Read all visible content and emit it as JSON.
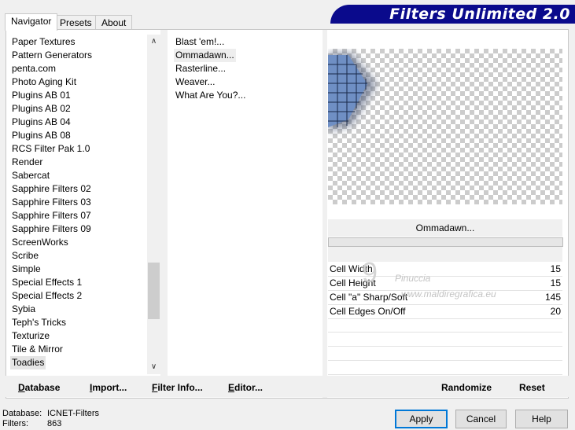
{
  "tabs": [
    {
      "label": "Navigator",
      "active": true
    },
    {
      "label": "Presets",
      "active": false
    },
    {
      "label": "About",
      "active": false
    }
  ],
  "banner": {
    "title": "Filters Unlimited 2.0"
  },
  "categories": [
    "Paper Textures",
    "Pattern Generators",
    "penta.com",
    "Photo Aging Kit",
    "Plugins AB 01",
    "Plugins AB 02",
    "Plugins AB 04",
    "Plugins AB 08",
    "RCS Filter Pak 1.0",
    "Render",
    "Sabercat",
    "Sapphire Filters 02",
    "Sapphire Filters 03",
    "Sapphire Filters 07",
    "Sapphire Filters 09",
    "ScreenWorks",
    "Scribe",
    "Simple",
    "Special Effects 1",
    "Special Effects 2",
    "Sybia",
    "Teph's Tricks",
    "Texturize",
    "Tile & Mirror",
    "Toadies"
  ],
  "selected_category": "Toadies",
  "filters": [
    "Blast 'em!...",
    "Ommadawn...",
    "Rasterline...",
    "Weaver...",
    "What Are You?..."
  ],
  "selected_filter": "Ommadawn...",
  "filter_name_label": "Ommadawn...",
  "parameters": [
    {
      "label": "Cell Width",
      "value": "15"
    },
    {
      "label": "Cell Height",
      "value": "15"
    },
    {
      "label": "Cell \"a\" Sharp/Soft",
      "value": "145"
    },
    {
      "label": "Cell Edges On/Off",
      "value": "20"
    }
  ],
  "left_buttons": {
    "database": {
      "underlined": "D",
      "rest": "atabase"
    },
    "import": {
      "underlined": "I",
      "rest": "mport..."
    },
    "filter_info": {
      "underlined": "F",
      "rest": "ilter Info..."
    },
    "editor": {
      "underlined": "E",
      "rest": "ditor..."
    }
  },
  "right_buttons": {
    "randomize": "Randomize",
    "reset": "Reset"
  },
  "status": {
    "database_label": "Database:",
    "database_value": "ICNET-Filters",
    "filters_label": "Filters:",
    "filters_value": "863"
  },
  "dialog_buttons": {
    "apply": "Apply",
    "cancel": "Cancel",
    "help": "Help"
  },
  "watermark": {
    "line1": "Pinuccia",
    "line2": "www.maldiregrafica.eu"
  },
  "colors": {
    "banner": "#0a0a8c",
    "grid_blue": "#6f8fc4",
    "default_border": "#0078d7"
  }
}
